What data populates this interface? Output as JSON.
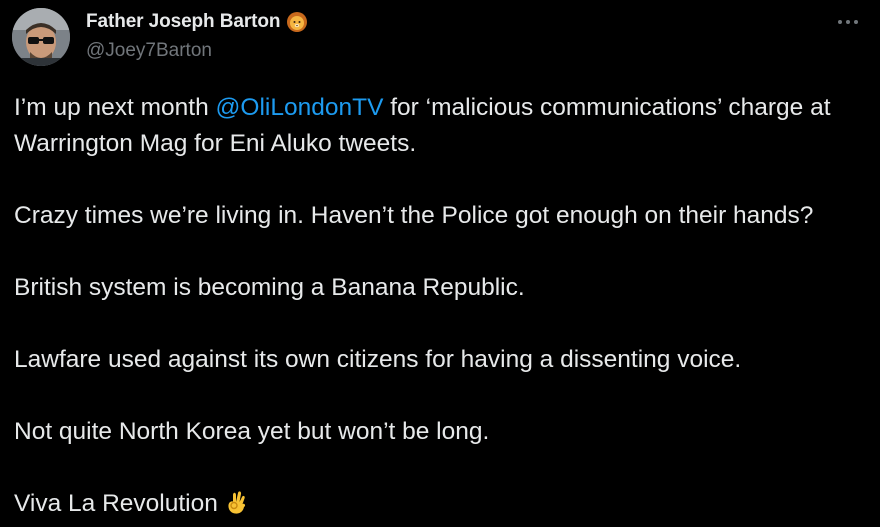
{
  "author": {
    "display_name": "Father Joseph Barton",
    "handle": "@Joey7Barton",
    "badge_icon": "lion-face-icon",
    "avatar_icon": "profile-photo"
  },
  "more_icon": "more-horizontal-icon",
  "tweet": {
    "line1_before": "I’m up next month ",
    "mention": "@OliLondonTV",
    "line1_after": " for ‘malicious communications’ charge at Warrington Mag for Eni Aluko tweets.",
    "p2": "Crazy times we’re living in. Haven’t the Police got enough on their hands?",
    "p3": "British system is becoming a Banana Republic.",
    "p4": "Lawfare used against its own citizens for having a dissenting voice.",
    "p5": "Not quite North Korea yet but won’t be long.",
    "p6": "Viva La Revolution",
    "p6_emoji_icon": "ok-hand-icon"
  },
  "colors": {
    "background": "#000000",
    "text": "#e7e9ea",
    "secondary": "#71767b",
    "link": "#1d9bf0"
  }
}
